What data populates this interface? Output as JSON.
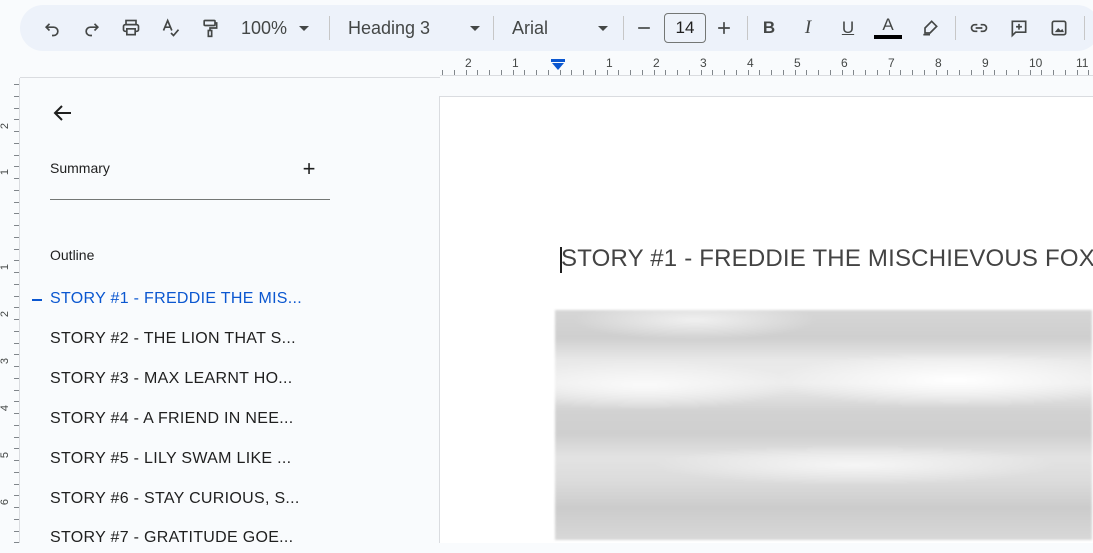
{
  "toolbar": {
    "zoom": "100%",
    "style": "Heading 3",
    "font": "Arial",
    "font_size": "14",
    "bold_label": "B",
    "italic_label": "I",
    "underline_label": "U",
    "text_color_label": "A"
  },
  "ruler": {
    "numbers": [
      "2",
      "1",
      "1",
      "2",
      "3",
      "4",
      "5",
      "6",
      "7",
      "8",
      "9",
      "10",
      "11"
    ],
    "vertical_numbers": [
      "2",
      "1",
      "1",
      "2",
      "3",
      "4",
      "5",
      "6"
    ]
  },
  "sidebar": {
    "summary_label": "Summary",
    "add_label": "+",
    "outline_label": "Outline",
    "items": [
      {
        "label": "STORY #1 - FREDDIE THE MIS...",
        "active": true
      },
      {
        "label": "STORY #2 - THE LION THAT S..."
      },
      {
        "label": "STORY #3 - MAX LEARNT HO..."
      },
      {
        "label": "STORY #4 - A FRIEND IN NEE..."
      },
      {
        "label": "STORY #5 - LILY SWAM LIKE ..."
      },
      {
        "label": "STORY #6 - STAY CURIOUS, S..."
      },
      {
        "label": "STORY #7 - GRATITUDE GOE..."
      }
    ]
  },
  "document": {
    "heading": "STORY #1 - FREDDIE THE MISCHIEVOUS FOX"
  },
  "icons": {
    "undo": "undo-icon",
    "redo": "redo-icon",
    "print": "print-icon",
    "spellcheck": "spellcheck-icon",
    "paint_format": "paint-format-icon",
    "highlight": "highlighter-icon",
    "link": "link-icon",
    "comment": "add-comment-icon",
    "image": "image-icon",
    "back": "arrow-back-icon"
  },
  "colors": {
    "accent": "#0b57d0",
    "toolbar_bg": "#edf2fa",
    "sidebar_bg": "#f9fbfd"
  }
}
